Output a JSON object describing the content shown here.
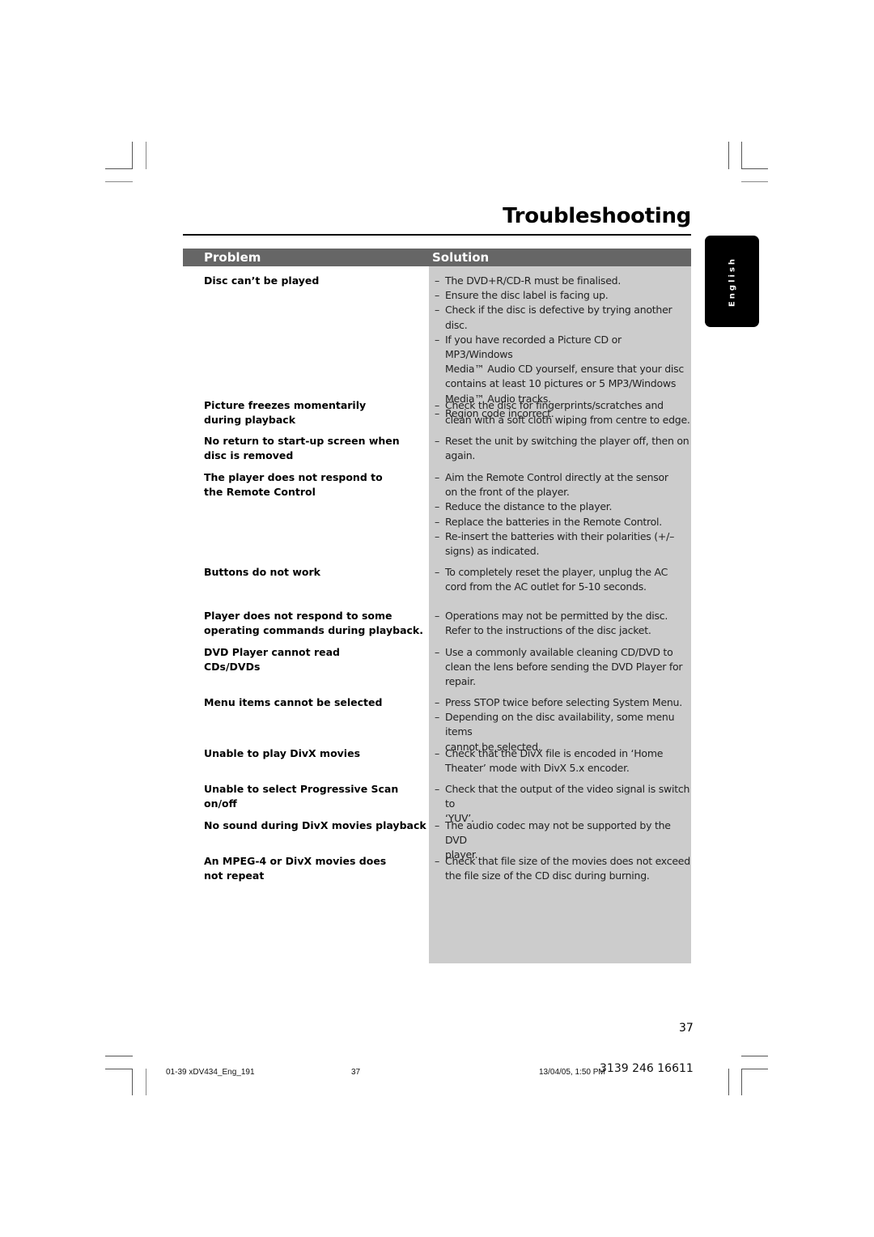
{
  "page": {
    "title": "Troubleshooting",
    "language_tab": "English",
    "page_number": "37"
  },
  "table": {
    "header_problem": "Problem",
    "header_solution": "Solution",
    "rows": [
      {
        "problem": [
          "Disc can’t be played"
        ],
        "solutions": [
          [
            "The DVD+R/CD-R must be finalised."
          ],
          [
            "Ensure the disc label is facing up."
          ],
          [
            "Check if the disc is defective by trying another disc."
          ],
          [
            "If you have recorded a Picture CD or MP3/Windows",
            "Media™ Audio CD yourself, ensure that your disc",
            "contains at least 10 pictures or 5 MP3/Windows",
            "Media™ Audio tracks."
          ],
          [
            "Region code incorrect."
          ]
        ]
      },
      {
        "problem": [
          "Picture freezes momentarily",
          "during playback"
        ],
        "solutions": [
          [
            "Check the disc for fingerprints/scratches and",
            "clean with a soft cloth wiping from centre to edge."
          ]
        ]
      },
      {
        "problem": [
          "No return to start-up screen when",
          "disc is removed"
        ],
        "solutions": [
          [
            "Reset the unit by switching the player off, then on",
            "again."
          ]
        ]
      },
      {
        "problem": [
          "The player does not respond to",
          "the Remote Control"
        ],
        "solutions": [
          [
            "Aim the Remote Control directly at the sensor",
            "on the front of the player."
          ],
          [
            "Reduce the distance to the player."
          ],
          [
            "Replace the batteries in the Remote Control."
          ],
          [
            "Re-insert the batteries with their polarities (+/–",
            "signs) as indicated."
          ]
        ]
      },
      {
        "problem": [
          "Buttons do not work"
        ],
        "solutions": [
          [
            "To completely reset the player, unplug the AC",
            "cord from the AC outlet for 5-10 seconds."
          ]
        ]
      },
      {
        "problem": [
          "Player does not respond to some",
          "operating commands during playback."
        ],
        "solutions": [
          [
            "Operations may not be permitted by the disc.",
            "Refer to the instructions of  the disc jacket."
          ]
        ]
      },
      {
        "problem": [
          "DVD Player cannot read",
          "CDs/DVDs"
        ],
        "solutions": [
          [
            "Use a commonly available cleaning CD/DVD to",
            "clean the lens before sending the DVD Player for",
            "repair."
          ]
        ]
      },
      {
        "problem": [
          "Menu items cannot be selected"
        ],
        "solutions": [
          [
            "Press STOP twice before selecting System Menu."
          ],
          [
            "Depending on the disc availability, some menu items",
            "cannot be selected."
          ]
        ]
      },
      {
        "problem": [
          "Unable to play DivX movies"
        ],
        "solutions": [
          [
            "Check that the DivX file is encoded in ‘Home",
            "Theater’ mode with DivX 5.x encoder."
          ]
        ]
      },
      {
        "problem": [
          "Unable to select Progressive Scan on/off"
        ],
        "solutions": [
          [
            "Check that the output of the video signal is switch to",
            "‘YUV’."
          ]
        ]
      },
      {
        "problem": [
          "No sound during DivX movies playback"
        ],
        "solutions": [
          [
            "The audio codec may not be supported by the DVD",
            "player."
          ]
        ]
      },
      {
        "problem": [
          "An MPEG-4 or DivX movies does",
          "not repeat"
        ],
        "solutions": [
          [
            "Check that file size of the movies does not exceed",
            "the file size of the CD disc during burning."
          ]
        ]
      }
    ]
  },
  "footer": {
    "file_name": "01-39 xDV434_Eng_191",
    "file_page": "37",
    "timestamp": "13/04/05, 1:50 PM",
    "doc_code": "3139 246 16611"
  }
}
